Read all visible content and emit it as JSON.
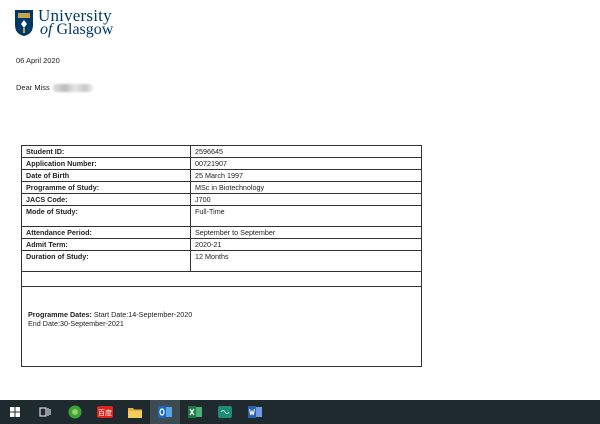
{
  "logo": {
    "line1": "University",
    "line2_prefix": "of",
    "line2": "Glasgow"
  },
  "letter": {
    "date": "06 April 2020",
    "greeting": "Dear Miss"
  },
  "details": [
    {
      "label": "Student ID:",
      "value": "2596645"
    },
    {
      "label": "Application Number:",
      "value": "00721907"
    },
    {
      "label": "Date of Birth",
      "value": "25 March 1997"
    },
    {
      "label": "Programme of Study:",
      "value": "MSc in Biotechnology"
    },
    {
      "label": "JACS Code:",
      "value": "J700"
    },
    {
      "label": "Mode of Study:",
      "value": "Full-Time"
    },
    {
      "label": "Attendance Period:",
      "value": "September to September"
    },
    {
      "label": "Admit Term:",
      "value": "2020-21"
    },
    {
      "label": "Duration of Study:",
      "value": "12  Months"
    }
  ],
  "programme": {
    "label": "Programme Dates:",
    "start": "Start Date:14-September-2020",
    "end": "End Date:30-September-2021"
  },
  "taskbar": {
    "items": [
      {
        "name": "windows-start-icon",
        "color": "#ffffff"
      },
      {
        "name": "task-view-icon",
        "color": "#ffffff"
      },
      {
        "name": "green-app-icon",
        "color": "#3aa335"
      },
      {
        "name": "red-app-icon",
        "color": "#d9261c"
      },
      {
        "name": "file-explorer-icon",
        "color": "#e8b43a"
      },
      {
        "name": "outlook-icon",
        "color": "#1a66c2"
      },
      {
        "name": "excel-icon",
        "color": "#1d7a45"
      },
      {
        "name": "teal-app-icon",
        "color": "#1f8a78"
      },
      {
        "name": "word-icon",
        "color": "#2b5fb5"
      }
    ],
    "red_app_label": "百度"
  }
}
